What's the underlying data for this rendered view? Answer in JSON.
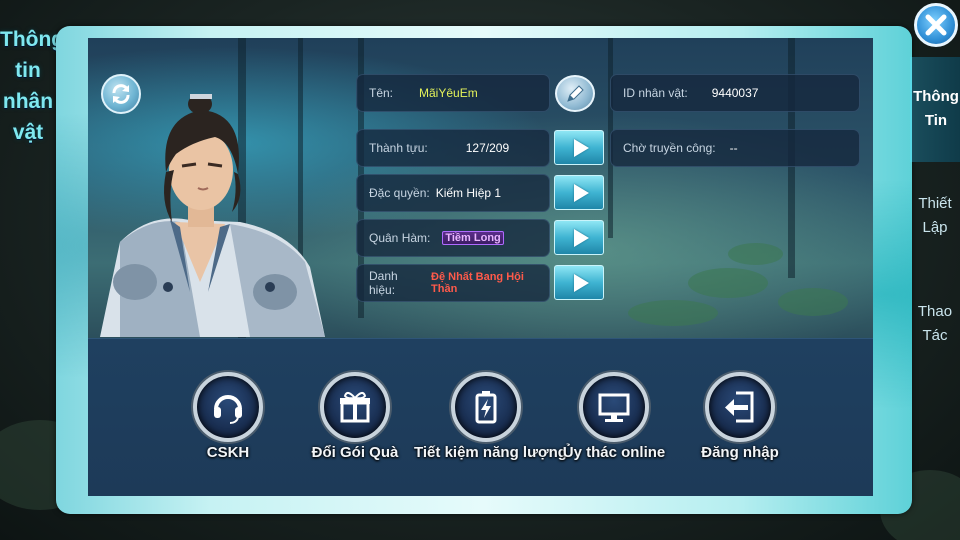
{
  "side_title": [
    "Thông",
    "tin",
    "nhân",
    "vật"
  ],
  "profile": {
    "name_label": "Tên:",
    "name_value": "MãiYêuEm",
    "id_label": "ID nhân vật:",
    "id_value": "9440037",
    "achievement_label": "Thành tựu:",
    "achievement_value": "127/209",
    "transfer_label": "Chờ truyền công:",
    "transfer_value": "--",
    "privilege_label": "Đặc quyền:",
    "privilege_value": "Kiếm Hiệp 1",
    "rank_label": "Quân Hàm:",
    "rank_value": "Tiềm Long",
    "title_label": "Danh hiệu:",
    "title_value": "Đệ Nhất Bang Hội Thần"
  },
  "actions": [
    {
      "label": "CSKH",
      "icon": "headset-icon"
    },
    {
      "label": "Đổi Gói Quà",
      "icon": "gift-icon"
    },
    {
      "label": "Tiết kiệm năng lượng",
      "icon": "battery-icon"
    },
    {
      "label": "Ủy thác online",
      "icon": "monitor-icon"
    },
    {
      "label": "Đăng nhập",
      "icon": "login-icon"
    }
  ],
  "side_tabs": {
    "info": [
      "Thông",
      "Tin"
    ],
    "settings": [
      "Thiết",
      "Lập"
    ],
    "operations": [
      "Thao",
      "Tác"
    ]
  },
  "colors": {
    "accent": "#58d8e6",
    "name_value": "#e3f25a",
    "title_value": "#ff5a4a",
    "rank_badge": "#b06bff"
  }
}
